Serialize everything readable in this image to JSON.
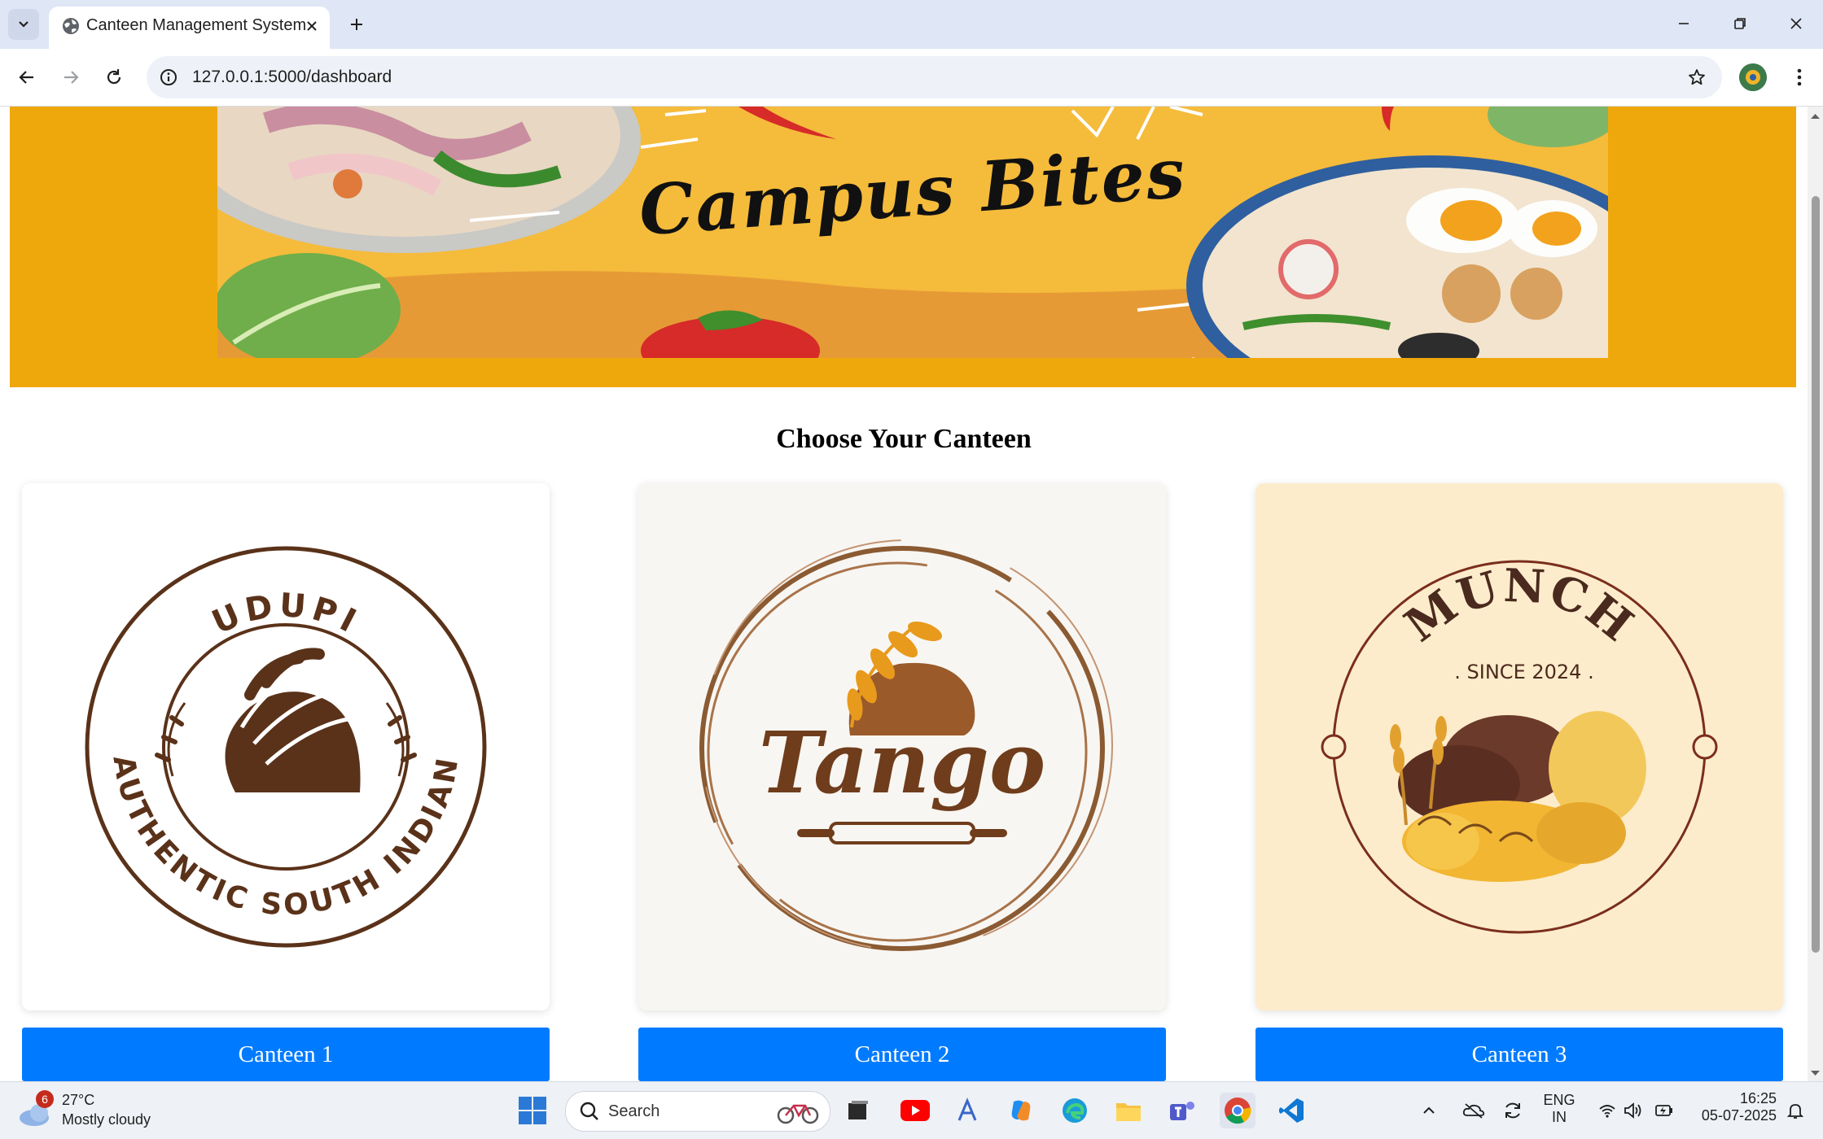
{
  "browser": {
    "tab_title": "Canteen Management System",
    "url": "127.0.0.1:5000/dashboard"
  },
  "banner": {
    "title": "Campus Bites"
  },
  "page": {
    "heading": "Choose Your Canteen"
  },
  "canteens": [
    {
      "button_label": "Canteen 1",
      "logo_top": "UDUPI",
      "logo_bottom": "AUTHENTIC SOUTH INDIAN",
      "bg": "#ffffff"
    },
    {
      "button_label": "Canteen 2",
      "logo_text": "Tango",
      "bg": "#f8f6f2"
    },
    {
      "button_label": "Canteen 3",
      "logo_top": "MUNCH",
      "logo_sub": ". SINCE 2024 .",
      "bg": "#fdeccb"
    }
  ],
  "colors": {
    "accent_button": "#007bff",
    "banner_bg": "#eea80c"
  },
  "taskbar": {
    "weather_badge": "6",
    "temperature": "27°C",
    "condition": "Mostly cloudy",
    "search_label": "Search",
    "lang_line1": "ENG",
    "lang_line2": "IN",
    "time": "16:25",
    "date": "05-07-2025"
  }
}
